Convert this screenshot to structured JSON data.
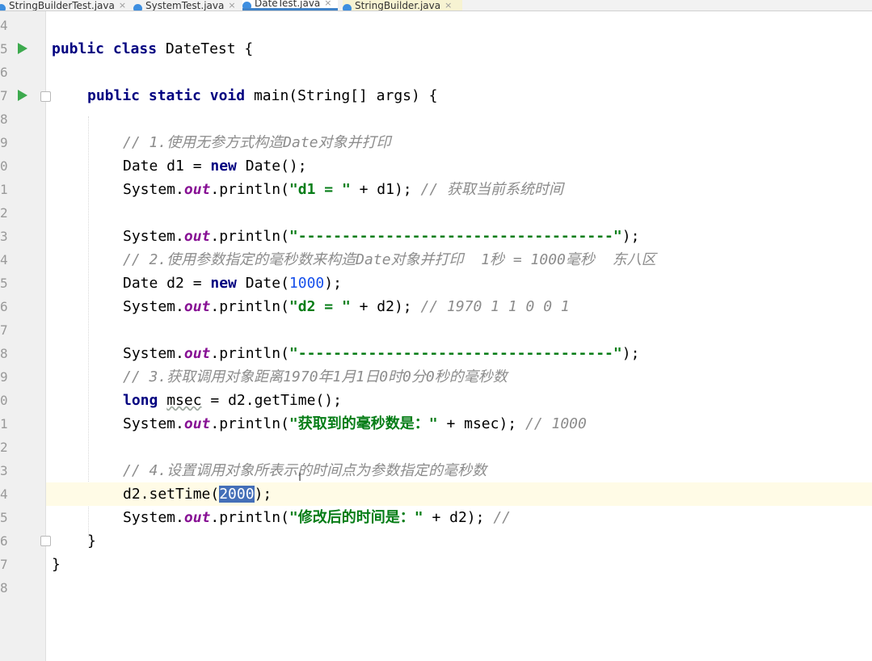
{
  "tabs": [
    {
      "label": "StringBuilderTest.java",
      "active": false
    },
    {
      "label": "SystemTest.java",
      "active": false
    },
    {
      "label": "DateTest.java",
      "active": true
    },
    {
      "label": "StringBuilder.java",
      "active": false
    }
  ],
  "close_glyph": "×",
  "line_numbers": [
    "4",
    "5",
    "6",
    "7",
    "8",
    "9",
    "0",
    "1",
    "2",
    "3",
    "4",
    "5",
    "6",
    "7",
    "8",
    "9",
    "0",
    "1",
    "2",
    "3",
    "4",
    "5",
    "6",
    "7",
    "8"
  ],
  "code": {
    "l5": {
      "kw1": "public",
      "kw2": "class",
      "name": " DateTest {"
    },
    "l7": {
      "kw1": "public",
      "kw2": "static",
      "kw3": "void",
      "rest": " main(String[] args) {"
    },
    "l9": {
      "comment": "// 1.使用无参方式构造Date对象并打印"
    },
    "l10": {
      "a": "Date d1 = ",
      "kw": "new",
      "b": " Date();"
    },
    "l11": {
      "a": "System.",
      "fld": "out",
      "b": ".println(",
      "str": "\"d1 = \"",
      "c": " + d1); ",
      "comment": "// 获取当前系统时间"
    },
    "l13": {
      "a": "System.",
      "fld": "out",
      "b": ".println(",
      "str": "\"------------------------------------\"",
      "c": ");"
    },
    "l14": {
      "comment": "// 2.使用参数指定的毫秒数来构造Date对象并打印  1秒 = 1000毫秒  东八区"
    },
    "l15": {
      "a": "Date d2 = ",
      "kw": "new",
      "b": " Date(",
      "num": "1000",
      "c": ");"
    },
    "l16": {
      "a": "System.",
      "fld": "out",
      "b": ".println(",
      "str": "\"d2 = \"",
      "c": " + d2); ",
      "comment": "// 1970 1 1 0 0 1"
    },
    "l18": {
      "a": "System.",
      "fld": "out",
      "b": ".println(",
      "str": "\"------------------------------------\"",
      "c": ");"
    },
    "l19": {
      "comment": "// 3.获取调用对象距离1970年1月1日0时0分0秒的毫秒数"
    },
    "l20": {
      "kw": "long",
      "sp": " ",
      "var": "msec",
      "b": " = d2.getTime();"
    },
    "l21": {
      "a": "System.",
      "fld": "out",
      "b": ".println(",
      "str": "\"获取到的毫秒数是：\"",
      "c": " + msec); ",
      "comment": "// 1000"
    },
    "l23": {
      "comment": "// 4.设置调用对象所表示的时间点为参数指定的毫秒数"
    },
    "l24": {
      "a": "d2.setTime(",
      "sel": "2000",
      "c": ");"
    },
    "l25": {
      "a": "System.",
      "fld": "out",
      "b": ".println(",
      "str": "\"修改后的时间是：\"",
      "c": " + d2); ",
      "comment": "//"
    },
    "l26": {
      "brace": "}"
    },
    "l27": {
      "brace": "}"
    }
  },
  "caret_glyph": "I",
  "colors": {
    "keyword": "#000080",
    "string": "#067d17",
    "number": "#1750eb",
    "comment": "#8c8c8c",
    "static_field": "#871094",
    "selection": "#446fb8",
    "current_line": "#fffbe6",
    "run_icon": "#3daa4e"
  },
  "icons": [
    "java-class-icon",
    "run-icon",
    "fold-icon",
    "bulb-icon",
    "text-caret-icon"
  ]
}
